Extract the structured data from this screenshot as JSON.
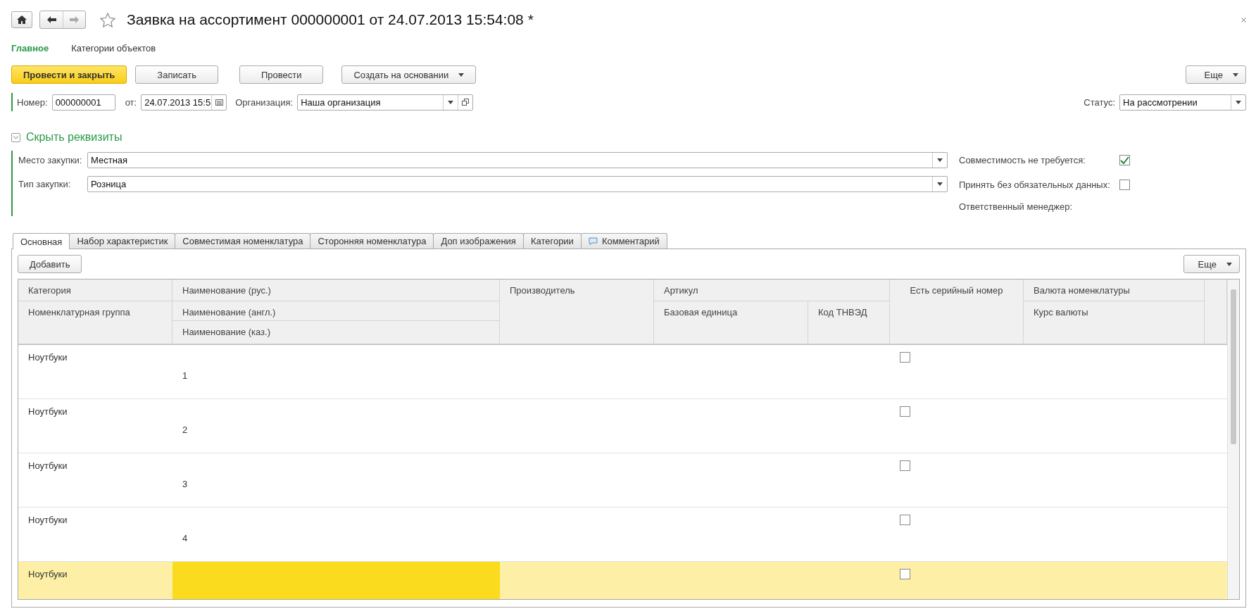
{
  "window": {
    "title": "Заявка на ассортимент 000000001 от 24.07.2013 15:54:08 *"
  },
  "section_tabs": [
    {
      "label": "Главное",
      "selected": true
    },
    {
      "label": "Категории объектов",
      "selected": false
    }
  ],
  "toolbar": {
    "buttons": [
      {
        "label": "Провести и закрыть",
        "kind": "primary"
      },
      {
        "label": "Записать",
        "kind": "plain"
      },
      {
        "label": "Провести",
        "kind": "plain"
      },
      {
        "label": "Создать на основании",
        "kind": "dropdown"
      }
    ],
    "more": "Еще"
  },
  "header_fields": {
    "number": {
      "label": "Номер:",
      "value": "000000001"
    },
    "date": {
      "label": "от:",
      "value": "24.07.2013 15:5"
    },
    "organization": {
      "label": "Организация:",
      "value": "Наша организация"
    },
    "status": {
      "label": "Статус:",
      "value": "На рассмотрении"
    }
  },
  "details": {
    "toggle": "Скрыть реквизиты",
    "expanded": true,
    "fields": [
      {
        "label": "Место закупки:",
        "value": "Местная"
      },
      {
        "label": "Тип закупки:",
        "value": "Розница"
      }
    ],
    "checks": [
      {
        "label": "Совместимость не требуется:",
        "checked": true
      },
      {
        "label": "Принять без обязательных данных:",
        "checked": false
      }
    ],
    "manager_label": "Ответственный менеджер:"
  },
  "tabs": [
    {
      "label": "Основная",
      "selected": true,
      "kind": "plain"
    },
    {
      "label": "Набор характеристик",
      "selected": false,
      "kind": "plain"
    },
    {
      "label": "Совместимая номенклатура",
      "selected": false,
      "kind": "plain"
    },
    {
      "label": "Сторонняя номенклатура",
      "selected": false,
      "kind": "plain"
    },
    {
      "label": "Доп изображения",
      "selected": false,
      "kind": "plain"
    },
    {
      "label": "Категории",
      "selected": false,
      "kind": "plain"
    },
    {
      "label": "Комментарий",
      "selected": false,
      "kind": "comment"
    }
  ],
  "table": {
    "add_button": "Добавить",
    "more": "Еще",
    "columns": {
      "category": "Категория",
      "group": "Номенклатурная группа",
      "name_ru": "Наименование (рус.)",
      "name_en": "Наименование (англ.)",
      "name_kz": "Наименование (каз.)",
      "maker": "Производитель",
      "article": "Артикул",
      "unit": "Базовая единица",
      "tnved": "Код ТНВЭД",
      "serial": "Есть серийный номер",
      "currency": "Валюта номенклатуры",
      "rate": "Курс валюты"
    },
    "rows": [
      {
        "category": "Ноутбуки",
        "number": "1",
        "serial": false,
        "selected": false
      },
      {
        "category": "Ноутбуки",
        "number": "2",
        "serial": false,
        "selected": false
      },
      {
        "category": "Ноутбуки",
        "number": "3",
        "serial": false,
        "selected": false
      },
      {
        "category": "Ноутбуки",
        "number": "4",
        "serial": false,
        "selected": false
      },
      {
        "category": "Ноутбуки",
        "serial": false,
        "selected": true
      }
    ]
  }
}
